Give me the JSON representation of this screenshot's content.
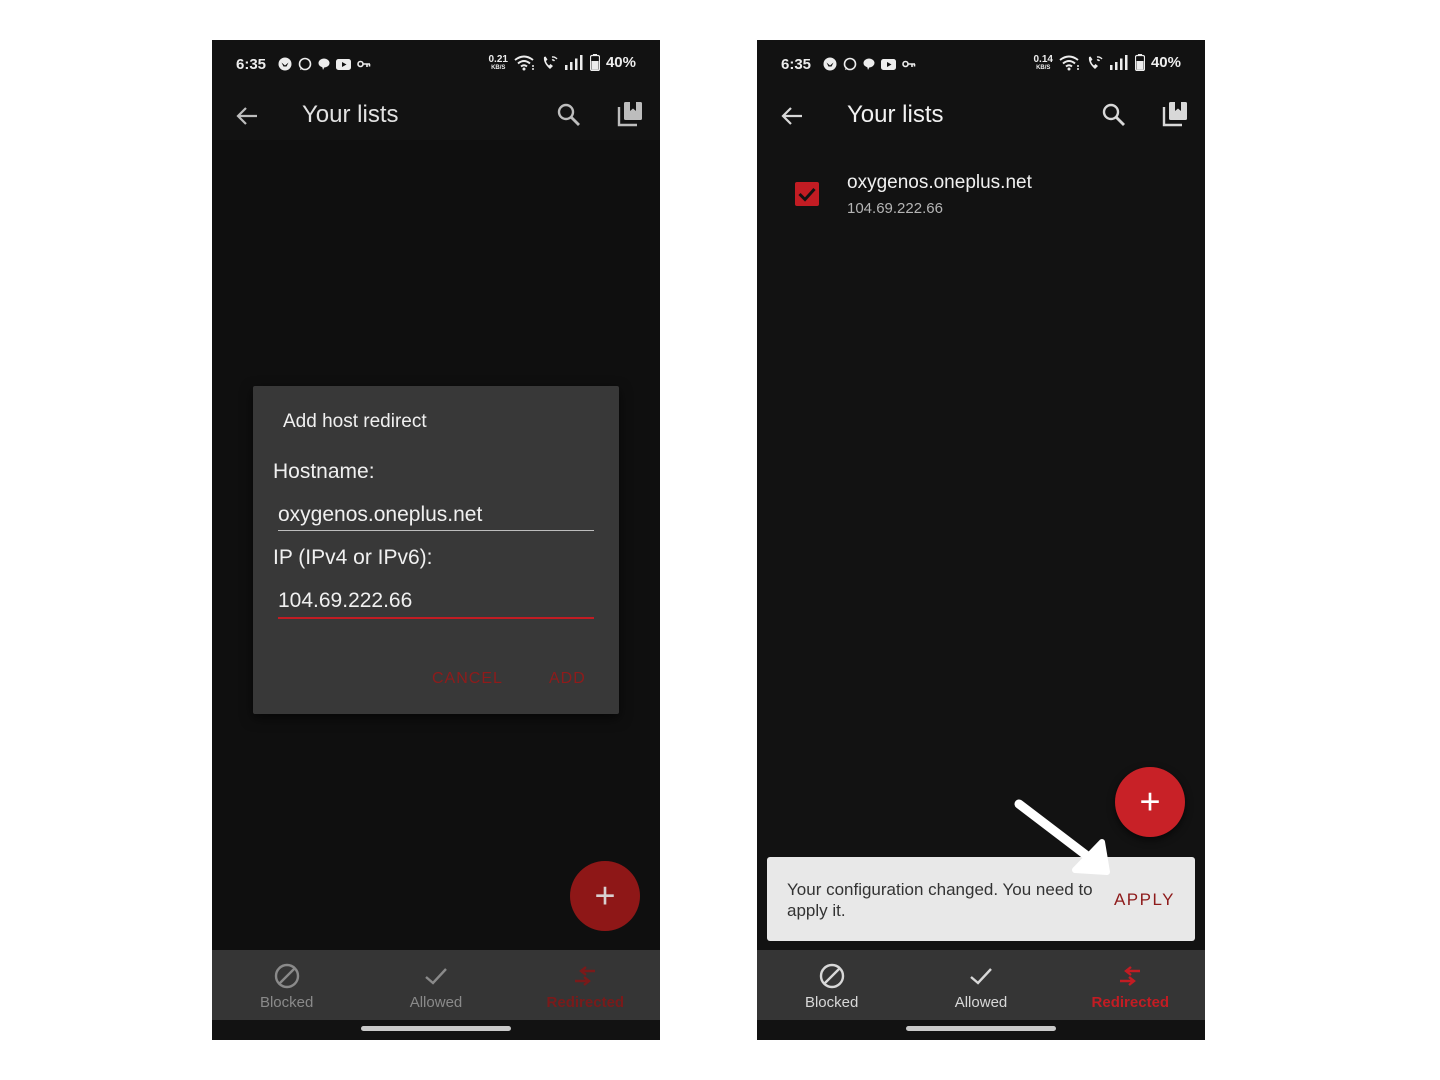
{
  "colors": {
    "accent": "#c21c23",
    "accent_dim": "#8e1b1b",
    "background": "#121212",
    "dialog_bg": "#383838",
    "nav_bg": "#353535",
    "snackbar_bg": "#e8e8e8"
  },
  "screens": [
    {
      "status_bar": {
        "time": "6:35",
        "net_speed_value": "0.21",
        "net_speed_unit": "KB/S",
        "battery": "40%",
        "icons": [
          "vpn-bird-icon",
          "whatsapp-icon",
          "chat-icon",
          "youtube-icon",
          "key-icon",
          "wifi-icon",
          "wifi-call-icon",
          "signal-icon",
          "battery-icon"
        ]
      },
      "app_bar": {
        "title": "Your lists",
        "icons": [
          "back-arrow-icon",
          "search-icon",
          "library-icon"
        ]
      },
      "dialog": {
        "title": "Add host redirect",
        "hostname_label": "Hostname:",
        "hostname_value": "oxygenos.oneplus.net",
        "ip_label": "IP (IPv4 or IPv6):",
        "ip_value": "104.69.222.66",
        "cancel_label": "CANCEL",
        "add_label": "ADD"
      },
      "fab": {
        "label": "+"
      },
      "bottom_nav": [
        {
          "label": "Blocked",
          "icon": "block-icon",
          "active": false
        },
        {
          "label": "Allowed",
          "icon": "check-icon",
          "active": false
        },
        {
          "label": "Redirected",
          "icon": "redirect-icon",
          "active": true
        }
      ]
    },
    {
      "status_bar": {
        "time": "6:35",
        "net_speed_value": "0.14",
        "net_speed_unit": "KB/S",
        "battery": "40%",
        "icons": [
          "vpn-bird-icon",
          "whatsapp-icon",
          "chat-icon",
          "youtube-icon",
          "key-icon",
          "wifi-icon",
          "wifi-call-icon",
          "signal-icon",
          "battery-icon"
        ]
      },
      "app_bar": {
        "title": "Your lists",
        "icons": [
          "back-arrow-icon",
          "search-icon",
          "library-icon"
        ]
      },
      "list": [
        {
          "hostname": "oxygenos.oneplus.net",
          "ip": "104.69.222.66",
          "checked": true
        }
      ],
      "fab": {
        "label": "+"
      },
      "snackbar": {
        "message": "Your configuration changed. You need to apply it.",
        "action_label": "APPLY"
      },
      "annotation": {
        "icon": "white-arrow-icon"
      },
      "bottom_nav": [
        {
          "label": "Blocked",
          "icon": "block-icon",
          "active": false
        },
        {
          "label": "Allowed",
          "icon": "check-icon",
          "active": false
        },
        {
          "label": "Redirected",
          "icon": "redirect-icon",
          "active": true
        }
      ]
    }
  ]
}
